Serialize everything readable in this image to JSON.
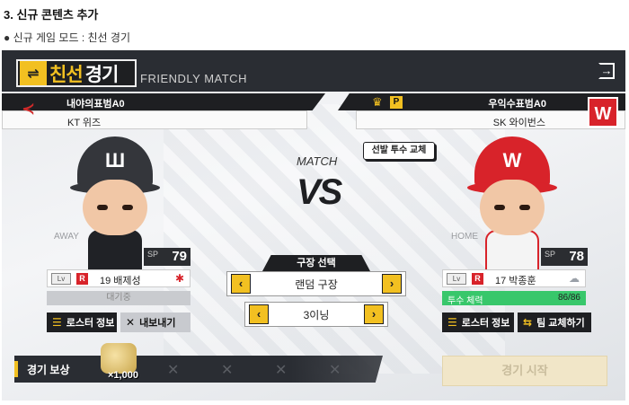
{
  "doc": {
    "heading": "3. 신규 콘텐츠 추가",
    "bullet": "● 신규 게임 모드 : 친선 경기"
  },
  "game": {
    "title_ko_part1": "친선",
    "title_ko_part2": "경기",
    "title_en": "FRIENDLY MATCH",
    "exit_icon": "exit-icon",
    "away_team": {
      "owner": "내야의표범A0",
      "team_name": "KT 위즈",
      "side_label": "AWAY",
      "sp_label": "SP",
      "sp_value": "79",
      "player": "19 배제성",
      "lv_badge": "Lv",
      "rank_badge": "R",
      "status": "대기중",
      "roster_button": "로스터 정보",
      "kick_button": "내보내기"
    },
    "home_team": {
      "owner": "우익수표범A0",
      "team_name": "SK 와이번스",
      "side_label": "HOME",
      "sp_label": "SP",
      "sp_value": "78",
      "player": "17 박종훈",
      "lv_badge": "Lv",
      "rank_badge": "R",
      "stamina_label": "투수 체력",
      "stamina_value": "86/86",
      "roster_button": "로스터 정보",
      "swap_button": "팀 교체하기",
      "p_badge": "P"
    },
    "match_label": "MATCH",
    "vs_label": "VS",
    "pitcher_change_button": "선발 투수 교체",
    "stadium": {
      "title": "구장 선택",
      "value": "랜덤 구장"
    },
    "innings": {
      "value": "3이닝"
    },
    "reward": {
      "label": "경기 보상",
      "amount": "×1,000"
    },
    "start_button": "경기 시작"
  },
  "colors": {
    "accent_yellow": "#f2c021",
    "dark": "#1e1f22",
    "sk_red": "#d8232a",
    "stamina_green": "#38c76b"
  }
}
